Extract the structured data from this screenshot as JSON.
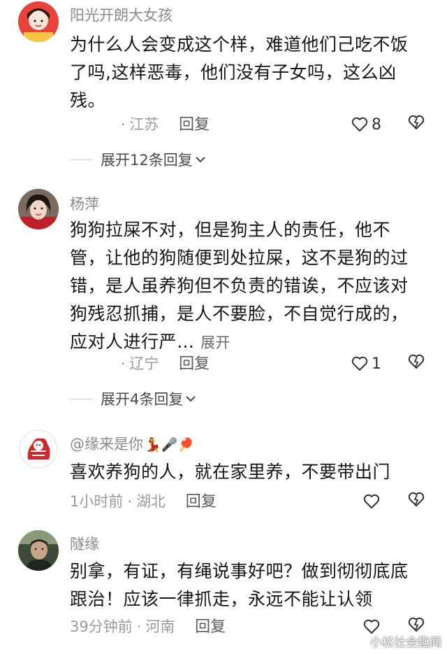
{
  "colors": {
    "text": "#151515",
    "meta": "#9a9a9a",
    "reply": "#5a5a5a",
    "background": "#ffffff"
  },
  "comments": [
    {
      "username": "阳光开朗大女孩",
      "text": "为什么人会变成这个样，难道他们己吃不饭了吗,这样恶毒，他们没有子女吗，这么凶残。",
      "time": "",
      "location": "江苏",
      "reply_label": "回复",
      "likes": "8",
      "more_replies": "展开12条回复"
    },
    {
      "username": "杨萍",
      "text": "狗狗拉屎不对，但是狗主人的责任，他不管，让他的狗随便到处拉屎，这不是狗的过错，是人虽养狗但不负责的错诶，不应该对狗残忍抓捕，是人不要脸，不自觉行成的，应对人进行严…",
      "expand_label": "展开",
      "time": "",
      "location": "辽宁",
      "reply_label": "回复",
      "likes": "1",
      "more_replies": "展开4条回复"
    },
    {
      "username": "@缘来是你",
      "username_emoji": "💃🎤🏓",
      "text": "喜欢养狗的人，就在家里养，不要带出门",
      "time": "1小时前",
      "location": "湖北",
      "reply_label": "回复",
      "likes": ""
    },
    {
      "username": "隧缘",
      "text": "别拿，有证，有绳说事好吧？做到彻彻底底跟治！应该一律抓走，永远不能让认领",
      "time": "39分钟前",
      "location": "河南",
      "reply_label": "回复",
      "likes": ""
    }
  ],
  "watermark": "小松社会趣闻",
  "icons": [
    "heart-icon",
    "dislike-icon",
    "chevron-down-icon"
  ]
}
